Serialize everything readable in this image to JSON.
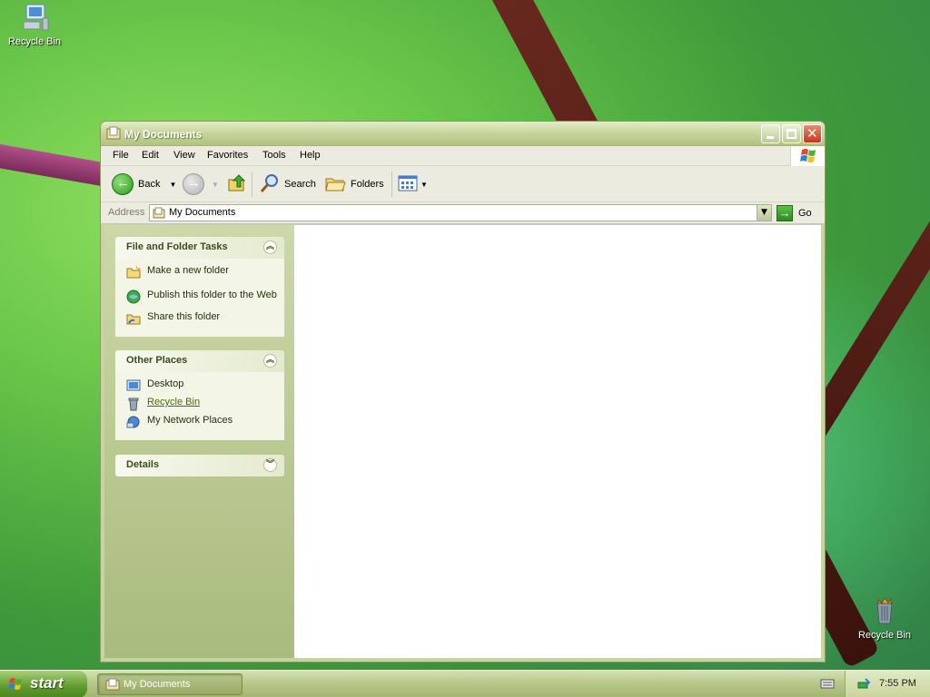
{
  "desktop": {
    "icons": [
      {
        "label": "Recycle Bin",
        "icon": "computer-icon"
      },
      {
        "label": "Recycle Bin",
        "icon": "recycle-bin-full-icon"
      }
    ]
  },
  "window": {
    "title": "My Documents",
    "menu": [
      "File",
      "Edit",
      "View",
      "Favorites",
      "Tools",
      "Help"
    ],
    "toolbar": {
      "back_label": "Back",
      "search_label": "Search",
      "folders_label": "Folders"
    },
    "address": {
      "label": "Address",
      "value": "My Documents",
      "go_label": "Go"
    },
    "taskpane": {
      "file_tasks": {
        "title": "File and Folder Tasks",
        "items": [
          "Make a new folder",
          "Publish this folder to the Web",
          "Share this folder"
        ]
      },
      "other_places": {
        "title": "Other Places",
        "items": [
          "Desktop",
          "Recycle Bin",
          "My Network Places"
        ]
      },
      "details": {
        "title": "Details"
      }
    }
  },
  "taskbar": {
    "start_label": "start",
    "items": [
      {
        "label": "My Documents"
      }
    ],
    "clock": "7:55 PM"
  },
  "colors": {
    "accent": "#b2c283",
    "content_bg": "#ffffff",
    "taskpane_bg": "#cdd8a9"
  }
}
